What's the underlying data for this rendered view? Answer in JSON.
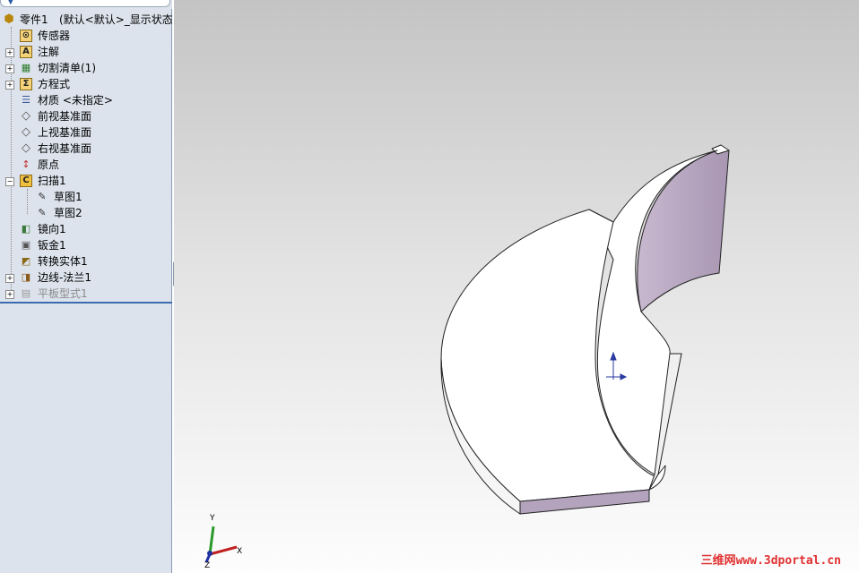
{
  "tree": {
    "part_name": "零件1",
    "part_config": "(默认<默认>_显示状态",
    "items": [
      {
        "label": "传感器",
        "icon": "sensor-icon"
      },
      {
        "label": "注解",
        "icon": "annotation-icon"
      },
      {
        "label": "切割清单(1)",
        "icon": "cut-list-icon"
      },
      {
        "label": "方程式",
        "icon": "equation-icon"
      },
      {
        "label": "材质 <未指定>",
        "icon": "material-icon"
      },
      {
        "label": "前视基准面",
        "icon": "plane-icon"
      },
      {
        "label": "上视基准面",
        "icon": "plane-icon"
      },
      {
        "label": "右视基准面",
        "icon": "plane-icon"
      },
      {
        "label": "原点",
        "icon": "origin-icon"
      },
      {
        "label": "扫描1",
        "icon": "sweep-icon"
      },
      {
        "label": "草图1",
        "icon": "sketch-icon"
      },
      {
        "label": "草图2",
        "icon": "sketch-icon"
      },
      {
        "label": "镜向1",
        "icon": "mirror-icon"
      },
      {
        "label": "钣金1",
        "icon": "sheet-metal-icon"
      },
      {
        "label": "转换实体1",
        "icon": "convert-solid-icon"
      },
      {
        "label": "边线-法兰1",
        "icon": "edge-flange-icon"
      },
      {
        "label": "平板型式1",
        "icon": "flat-pattern-icon"
      }
    ]
  },
  "triad": {
    "x_label": "X",
    "y_label": "Y",
    "z_label": "Z"
  },
  "watermark": {
    "cn": "三维网",
    "url": "www.3dportal.cn"
  }
}
